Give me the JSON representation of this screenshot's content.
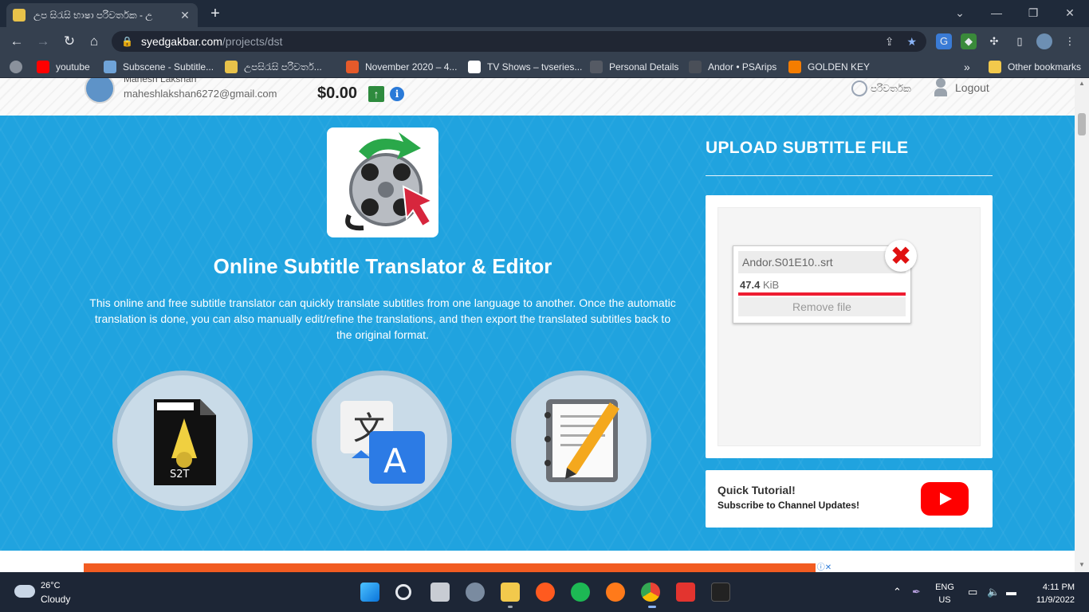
{
  "browser": {
    "tab_title": "උප සිරැසි භාෂා පරිවර්තක - උ",
    "tab_close": "✕",
    "new_tab": "+",
    "win_min": "⌄",
    "win_minimize": "—",
    "win_restore": "❐",
    "win_close": "✕",
    "nav_back": "←",
    "nav_forward": "→",
    "nav_reload": "↻",
    "nav_home": "⌂",
    "url_host": "syedgakbar.com",
    "url_path": "/projects/dst",
    "bookmarks": [
      {
        "label": "youtube",
        "color": "#ff0000"
      },
      {
        "label": "Subscene - Subtitle...",
        "color": "#6fa3d8"
      },
      {
        "label": "උපසිරැසි පරිවර්ත...",
        "color": "#e8c24a"
      },
      {
        "label": "November 2020 – 4...",
        "color": "#e55a2a"
      },
      {
        "label": "TV Shows – tvseries...",
        "color": "#ffffff"
      },
      {
        "label": "Personal Details",
        "color": "#555a64"
      },
      {
        "label": "Andor • PSArips",
        "color": "#4a4f58"
      },
      {
        "label": "GOLDEN KEY",
        "color": "#f57d00"
      }
    ],
    "bookmarks_more": "»",
    "other_bookmarks": "Other bookmarks"
  },
  "page": {
    "user": {
      "name": "Mahesh Lakshan",
      "email": "maheshlakshan6272@gmail.com"
    },
    "balance": "$0.00",
    "balance_up_icon": "↑",
    "info_icon": "i",
    "language_link": "පරිවර්තක",
    "logout": "Logout",
    "hero": {
      "title": "Online Subtitle Translator & Editor",
      "description": "This online and free subtitle translator can quickly translate subtitles from one language to another. Once the automatic translation is done, you can also manually edit/refine the translations, and then export the translated subtitles back to the original format."
    },
    "upload": {
      "heading": "UPLOAD SUBTITLE FILE",
      "file_name": "Andor.S01E10..srt",
      "file_size_value": "47.4",
      "file_size_unit": "KiB",
      "progress": 1.0,
      "remove_label": "Remove file",
      "remove_icon": "✖"
    },
    "tutorial": {
      "title": "Quick Tutorial!",
      "subtitle": "Subscribe to Channel Updates!"
    }
  },
  "taskbar": {
    "temperature": "26°C",
    "condition": "Cloudy",
    "lang_line1": "ENG",
    "lang_line2": "US",
    "time": "4:11 PM",
    "date": "11/9/2022"
  },
  "colors": {
    "hero_bg": "#20a3df",
    "youtube_red": "#ff0000",
    "progress_red": "#ee1c31"
  }
}
